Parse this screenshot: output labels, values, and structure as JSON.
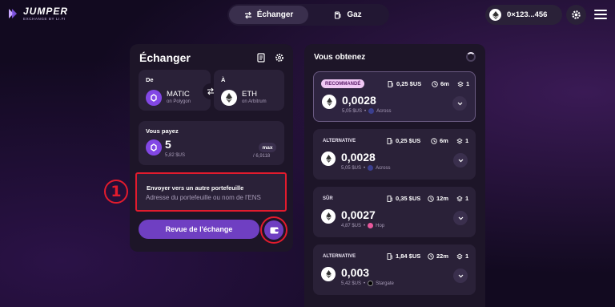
{
  "header": {
    "logo_title": "JUMPER",
    "logo_subtitle": "EXCHANGE BY LI.FI",
    "tabs": [
      {
        "label": "Échanger",
        "active": true
      },
      {
        "label": "Gaz",
        "active": false
      }
    ],
    "wallet_address": "0×123...456"
  },
  "exchange": {
    "title": "Échanger",
    "from": {
      "label": "De",
      "token": "MATIC",
      "chain": "on Polygon"
    },
    "to": {
      "label": "À",
      "token": "ETH",
      "chain": "on Arbitrum"
    },
    "pay": {
      "label": "Vous payez",
      "amount": "5",
      "usd": "5,82 $US",
      "max_label": "max",
      "balance": "/ 6,9118"
    },
    "send": {
      "title": "Envoyer vers un autre portefeuille",
      "placeholder": "Adresse du portefeuille ou nom de l'ENS"
    },
    "callout_number": "1",
    "review_label": "Revue de l'échange"
  },
  "results": {
    "title": "Vous obtenez",
    "routes": [
      {
        "tag": "RECOMMANDÉ",
        "gas": "0,25 $US",
        "time": "6m",
        "steps": "1",
        "amount": "0,0028",
        "usd": "5,05 $US",
        "tool": "Across"
      },
      {
        "tag": "ALTERNATIVE",
        "gas": "0,25 $US",
        "time": "6m",
        "steps": "1",
        "amount": "0,0028",
        "usd": "5,05 $US",
        "tool": "Across"
      },
      {
        "tag": "SÛR",
        "gas": "0,35 $US",
        "time": "12m",
        "steps": "1",
        "amount": "0,0027",
        "usd": "4,87 $US",
        "tool": "Hop"
      },
      {
        "tag": "ALTERNATIVE",
        "gas": "1,84 $US",
        "time": "22m",
        "steps": "1",
        "amount": "0,003",
        "usd": "5,42 $US",
        "tool": "Stargate"
      }
    ]
  },
  "colors": {
    "accent": "#6f3fc2",
    "highlight": "#e21b2d",
    "panel": "#1d1528",
    "card": "#2a2138"
  }
}
